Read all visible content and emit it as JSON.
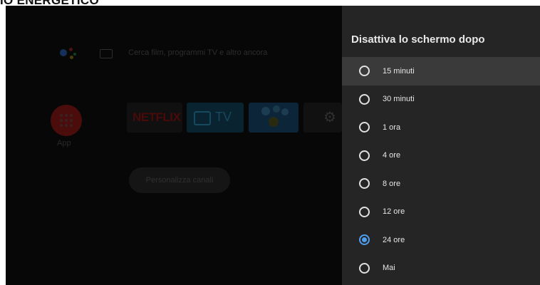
{
  "page_heading": "IO ENERGETICO",
  "home": {
    "search_hint": "Cerca film, programmi TV e altro ancora",
    "apps_label": "App",
    "tiles": {
      "netflix_label": "NETFLIX",
      "tv_label": "TV"
    },
    "customize_channels_label": "Personalizza canali",
    "icons": {
      "assistant": "google-assistant-icon",
      "keyboard": "keyboard-icon",
      "apps": "apps-grid-icon",
      "tv": "tv-icon",
      "kids": "kids-app-icon",
      "settings": "gear-icon"
    }
  },
  "panel": {
    "title": "Disattiva lo schermo dopo",
    "focused_index": 0,
    "selected_index": 6,
    "options": [
      {
        "label": "15 minuti"
      },
      {
        "label": "30 minuti"
      },
      {
        "label": "1 ora"
      },
      {
        "label": "4 ore"
      },
      {
        "label": "8 ore"
      },
      {
        "label": "12 ore"
      },
      {
        "label": "24 ore"
      },
      {
        "label": "Mai"
      }
    ]
  },
  "colors": {
    "panel_background": "#252525",
    "focus_highlight": "#3a3a3a",
    "radio_selected": "#4f9ded",
    "screen_background": "#000000"
  }
}
